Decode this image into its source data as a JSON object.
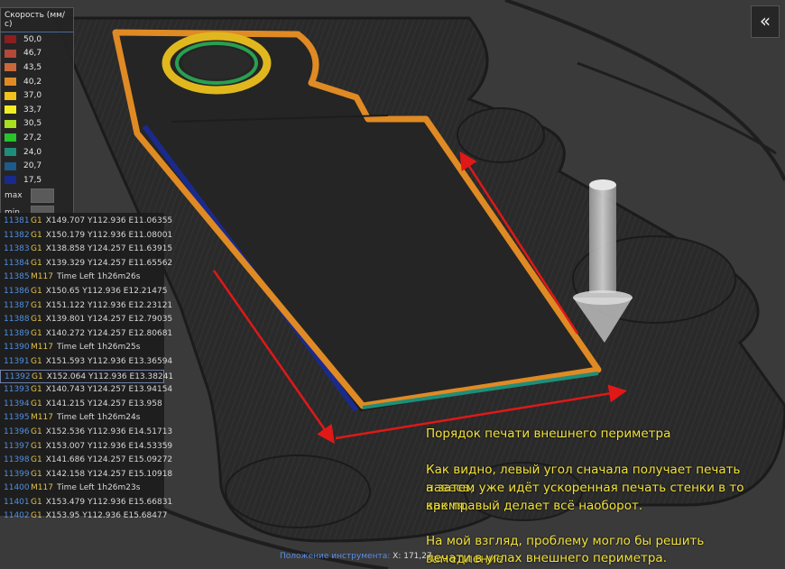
{
  "legend": {
    "title": "Скорость (мм/с)",
    "items": [
      {
        "label": "50,0",
        "color": "#8b1e1e"
      },
      {
        "label": "46,7",
        "color": "#b14a3a"
      },
      {
        "label": "43,5",
        "color": "#c96838"
      },
      {
        "label": "40,2",
        "color": "#e08a24"
      },
      {
        "label": "37,0",
        "color": "#f0c21a"
      },
      {
        "label": "33,7",
        "color": "#f2ec22"
      },
      {
        "label": "30,5",
        "color": "#a6e020"
      },
      {
        "label": "27,2",
        "color": "#28c42a"
      },
      {
        "label": "24,0",
        "color": "#1e8e7a"
      },
      {
        "label": "20,7",
        "color": "#1d5a8a"
      },
      {
        "label": "17,5",
        "color": "#1a2a8c"
      }
    ],
    "max_label": "max",
    "min_label": "min"
  },
  "gcode": [
    {
      "num": "11381",
      "cmd": "G1",
      "args": "X149.707 Y112.936 E11.06355"
    },
    {
      "num": "11382",
      "cmd": "G1",
      "args": "X150.179 Y112.936 E11.08001"
    },
    {
      "num": "11383",
      "cmd": "G1",
      "args": "X138.858 Y124.257 E11.63915"
    },
    {
      "num": "11384",
      "cmd": "G1",
      "args": "X139.329 Y124.257 E11.65562"
    },
    {
      "num": "11385",
      "cmd": "M117",
      "args": "Time Left 1h26m26s"
    },
    {
      "num": "11386",
      "cmd": "G1",
      "args": "X150.65 Y112.936 E12.21475"
    },
    {
      "num": "11387",
      "cmd": "G1",
      "args": "X151.122 Y112.936 E12.23121"
    },
    {
      "num": "11388",
      "cmd": "G1",
      "args": "X139.801 Y124.257 E12.79035"
    },
    {
      "num": "11389",
      "cmd": "G1",
      "args": "X140.272 Y124.257 E12.80681"
    },
    {
      "num": "11390",
      "cmd": "M117",
      "args": "Time Left 1h26m25s"
    },
    {
      "num": "11391",
      "cmd": "G1",
      "args": "X151.593 Y112.936 E13.36594"
    },
    {
      "num": "11392",
      "cmd": "G1",
      "args": "X152.064 Y112.936 E13.38241"
    },
    {
      "num": "11393",
      "cmd": "G1",
      "args": "X140.743 Y124.257 E13.94154"
    },
    {
      "num": "11394",
      "cmd": "G1",
      "args": "X141.215 Y124.257 E13.958"
    },
    {
      "num": "11395",
      "cmd": "M117",
      "args": "Time Left 1h26m24s"
    },
    {
      "num": "11396",
      "cmd": "G1",
      "args": "X152.536 Y112.936 E14.51713"
    },
    {
      "num": "11397",
      "cmd": "G1",
      "args": "X153.007 Y112.936 E14.53359"
    },
    {
      "num": "11398",
      "cmd": "G1",
      "args": "X141.686 Y124.257 E15.09272"
    },
    {
      "num": "11399",
      "cmd": "G1",
      "args": "X142.158 Y124.257 E15.10918"
    },
    {
      "num": "11400",
      "cmd": "M117",
      "args": "Time Left 1h26m23s"
    },
    {
      "num": "11401",
      "cmd": "G1",
      "args": "X153.479 Y112.936 E15.66831"
    },
    {
      "num": "11402",
      "cmd": "G1",
      "args": "X153.95 Y112.936 E15.68477"
    }
  ],
  "selected_line": "11392",
  "collapse_icon": "double-chevron-icon",
  "collapse_glyph": "«",
  "annotation": {
    "title": "Порядок печати внешнего периметра",
    "p1_l1": "Как видно, левый угол сначала получает печать навеса,",
    "p1_l2": "а затем уже идёт ускоренная печать стенки в то время,",
    "p1_l3": "как правый делает всё наоборот.",
    "p2_l1": "На мой взгляд, проблему могло бы решить замедление",
    "p2_l2": "печати в углах внешнего периметра."
  },
  "status": {
    "label": "Положение инструмента:",
    "value": "X: 171,27"
  },
  "colors": {
    "background": "#3a3a3a",
    "model": "#262626",
    "perimeter_orange": "#e08a24",
    "perimeter_blue": "#1a2a8c",
    "annotation_yellow": "#f2e23a",
    "arrow_red": "#e01818"
  }
}
